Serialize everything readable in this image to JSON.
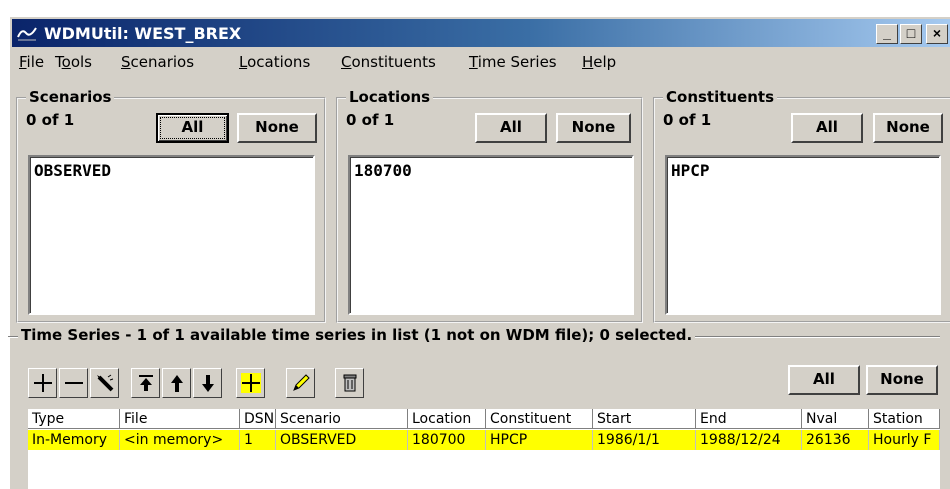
{
  "window": {
    "title": "WDMUtil: WEST_BREX",
    "minimize": "_",
    "maximize": "□",
    "close": "×"
  },
  "menu": [
    {
      "pre": "",
      "u": "F",
      "post": "ile"
    },
    {
      "pre": "T",
      "u": "o",
      "post": "ols"
    },
    {
      "pre": "",
      "u": "S",
      "post": "cenarios"
    },
    {
      "pre": "",
      "u": "L",
      "post": "ocations"
    },
    {
      "pre": "",
      "u": "C",
      "post": "onstituents"
    },
    {
      "pre": "",
      "u": "T",
      "post": "ime Series"
    },
    {
      "pre": "",
      "u": "H",
      "post": "elp"
    }
  ],
  "scenarios": {
    "title": "Scenarios",
    "count": "0 of 1",
    "all": "All",
    "none": "None",
    "items": [
      "OBSERVED"
    ]
  },
  "locations": {
    "title": "Locations",
    "count": "0 of 1",
    "all": "All",
    "none": "None",
    "items": [
      "180700"
    ]
  },
  "constituents": {
    "title": "Constituents",
    "count": "0 of 1",
    "all": "All",
    "none": "None",
    "items": [
      "HPCP"
    ]
  },
  "timeseries": {
    "title": "Time Series  -  1 of 1 available time series in list (1 not on WDM file);  0 selected.",
    "all": "All",
    "none": "None",
    "tools": [
      "add-icon",
      "remove-icon",
      "clear-icon",
      "move-top-icon",
      "move-up-icon",
      "move-down-icon",
      "select-all-icon",
      "edit-icon",
      "delete-icon"
    ],
    "columns": [
      "Type",
      "File",
      "DSN",
      "Scenario",
      "Location",
      "Constituent",
      "Start",
      "End",
      "Nval",
      "Station"
    ],
    "rows": [
      [
        "In-Memory",
        "<in memory>",
        "1",
        "OBSERVED",
        "180700",
        "HPCP",
        "1986/1/1",
        "1988/12/24",
        "26136",
        "Hourly F"
      ]
    ]
  },
  "colors": {
    "selected_row": "#ffff00",
    "face": "#d4d0c8",
    "title_start": "#0a246a",
    "title_end": "#a6caf0"
  }
}
